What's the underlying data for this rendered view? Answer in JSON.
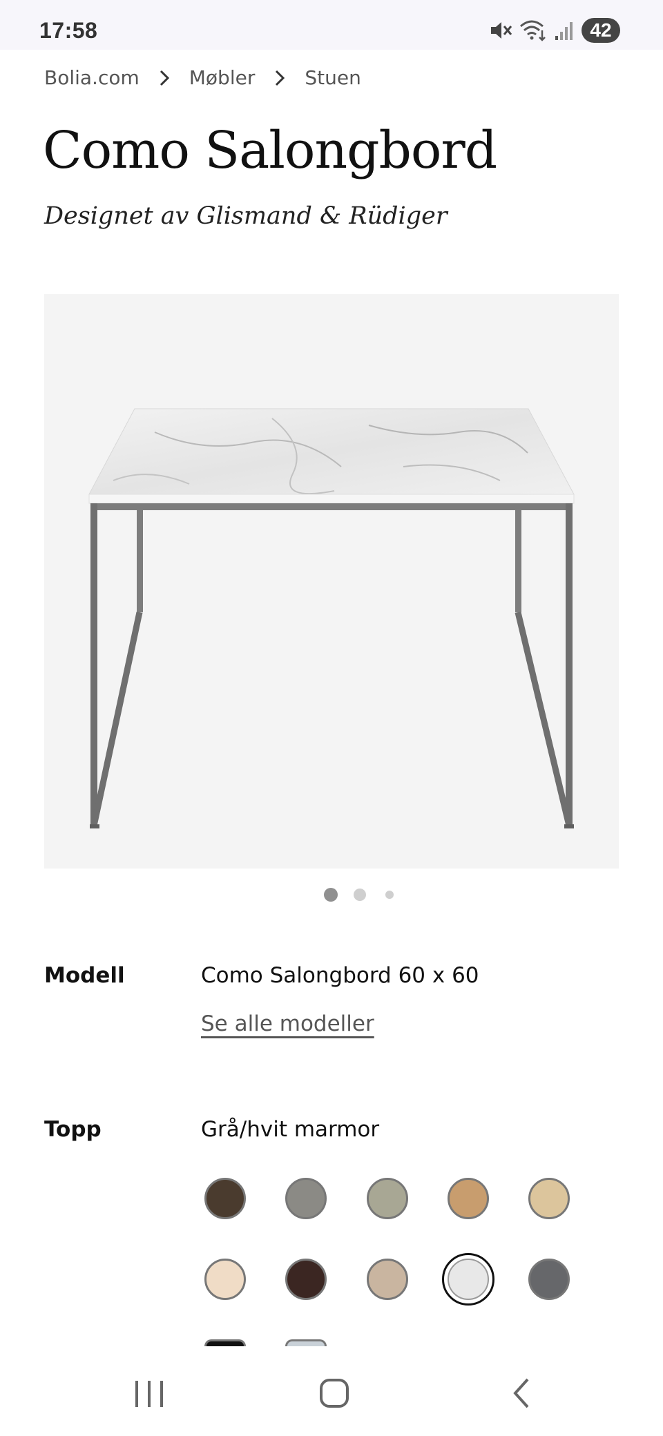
{
  "status_bar": {
    "time": "17:58",
    "battery": "42",
    "icons": [
      "mute-icon",
      "wifi-icon",
      "signal-icon",
      "battery-icon"
    ]
  },
  "breadcrumb": {
    "items": [
      "Bolia.com",
      "Møbler",
      "Stuen"
    ]
  },
  "product": {
    "title": "Como Salongbord",
    "designer": "Designet av Glismand & Rüdiger",
    "image_alt": "product-image",
    "carousel": {
      "count": 3,
      "active_index": 0
    }
  },
  "specs": {
    "model_label": "Modell",
    "model_value": "Como Salongbord 60 x 60",
    "see_all_models": "Se alle modeller",
    "top_label": "Topp",
    "top_value": "Grå/hvit marmor"
  },
  "swatches": [
    {
      "name": "dark-oak",
      "color": "#4a3b2e"
    },
    {
      "name": "grey-stone",
      "color": "#8b8a85"
    },
    {
      "name": "sage-stone",
      "color": "#a8a794"
    },
    {
      "name": "oiled-oak",
      "color": "#c89d6e"
    },
    {
      "name": "light-oak",
      "color": "#dcc59c"
    },
    {
      "name": "cream",
      "color": "#f0dcc6"
    },
    {
      "name": "brown-marble",
      "color": "#3b2622"
    },
    {
      "name": "travertine",
      "color": "#c9b5a0"
    },
    {
      "name": "grey-white-marble",
      "color": "#e8e8e8",
      "selected": true
    },
    {
      "name": "dark-grey-marble",
      "color": "#66676a"
    },
    {
      "name": "black-marble",
      "color": "#111111"
    },
    {
      "name": "light-blue-grey",
      "color": "#c9d1d8"
    }
  ],
  "nav": {
    "buttons": [
      "recent-apps-button",
      "home-button",
      "back-button"
    ]
  }
}
